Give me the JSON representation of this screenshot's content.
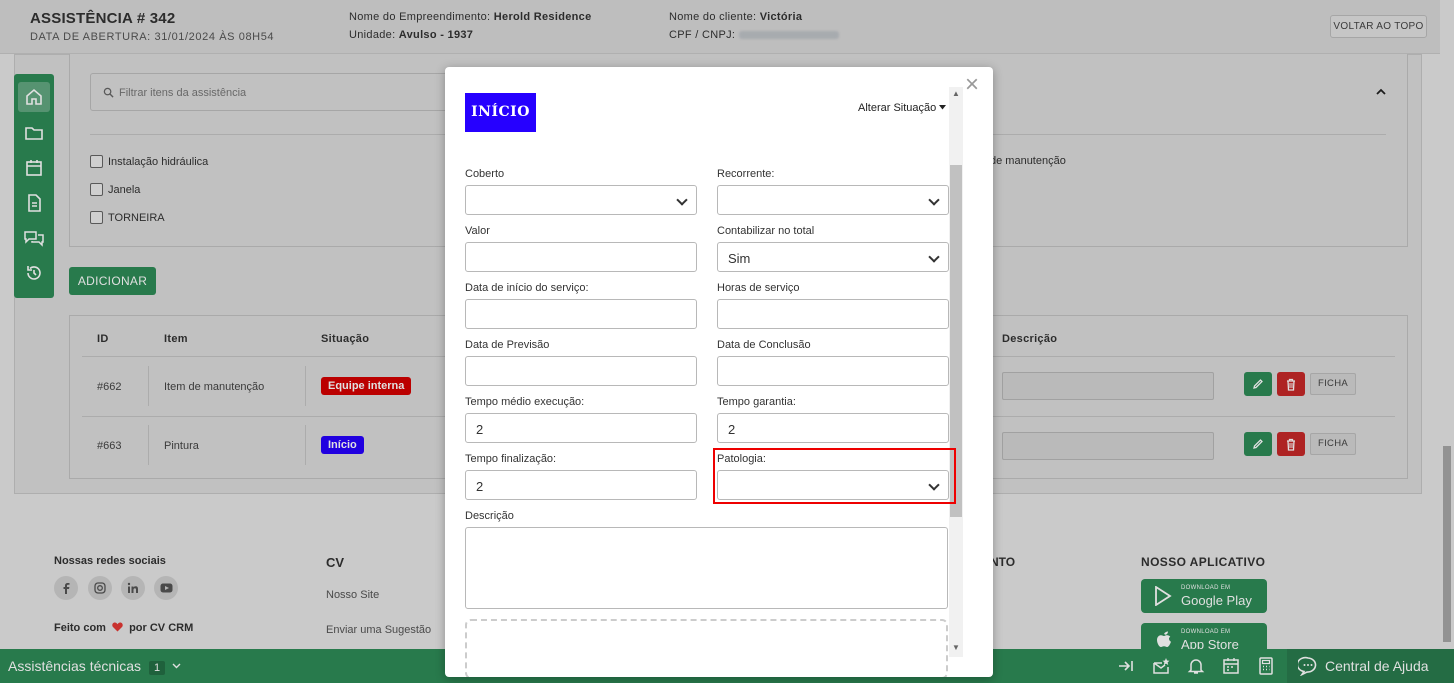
{
  "header": {
    "title": "ASSISTÊNCIA # 342",
    "opened": "DATA DE ABERTURA: 31/01/2024 ÀS 08H54",
    "enterprise_label": "Nome do Empreendimento:",
    "enterprise_value": "Herold Residence",
    "unit_label": "Unidade:",
    "unit_value": "Avulso - 1937",
    "client_label": "Nome do cliente:",
    "client_value": "Victória",
    "cpf_label": "CPF / CNPJ:",
    "back_top": "VOLTAR AO TOPO"
  },
  "filter": {
    "placeholder": "Filtrar itens da assistência"
  },
  "checkboxes": [
    "Instalação hidráulica",
    "Janela",
    "TORNEIRA",
    "de manutenção"
  ],
  "add_button": "ADICIONAR",
  "table": {
    "headers": [
      "ID",
      "Item",
      "Situação",
      "Descrição"
    ],
    "rows": [
      {
        "id": "#662",
        "item": "Item de manutenção",
        "status": "Equipe interna",
        "status_color": "#d50000"
      },
      {
        "id": "#663",
        "item": "Pintura",
        "status": "Início",
        "status_color": "#2600ff"
      }
    ],
    "ficha_label": "FICHA"
  },
  "footer": {
    "social_title": "Nossas redes sociais",
    "made_with_prefix": "Feito com",
    "made_with_suffix": "por CV CRM",
    "cv_title": "CV",
    "cv_links": [
      "Nosso Site",
      "Enviar uma Sugestão"
    ],
    "partial_title": "NTO",
    "app_title": "NOSSO APLICATIVO",
    "google_small": "DOWNLOAD EM",
    "google_big": "Google Play",
    "apple_small": "DOWNLOAD EM",
    "apple_big": "App Store"
  },
  "bottom_bar": {
    "label": "Assistências técnicas",
    "count": "1",
    "help": "Central de Ajuda"
  },
  "modal": {
    "status": "INÍCIO",
    "status_color": "#2600ff",
    "change_status": "Alterar Situação",
    "fields": {
      "coberto": {
        "label": "Coberto",
        "value": ""
      },
      "recorrente": {
        "label": "Recorrente:",
        "value": ""
      },
      "valor": {
        "label": "Valor",
        "value": ""
      },
      "contabilizar": {
        "label": "Contabilizar no total",
        "value": "Sim"
      },
      "data_inicio": {
        "label": "Data de início do serviço:",
        "value": ""
      },
      "horas": {
        "label": "Horas de serviço",
        "value": ""
      },
      "data_previsao": {
        "label": "Data de Previsão",
        "value": ""
      },
      "data_conclusao": {
        "label": "Data de Conclusão",
        "value": ""
      },
      "tempo_medio": {
        "label": "Tempo médio execução:",
        "value": "2"
      },
      "tempo_garantia": {
        "label": "Tempo garantia:",
        "value": "2"
      },
      "tempo_finalizacao": {
        "label": "Tempo finalização:",
        "value": "2"
      },
      "patologia": {
        "label": "Patologia:",
        "value": ""
      },
      "descricao": {
        "label": "Descrição",
        "value": ""
      }
    }
  },
  "colors": {
    "brand_green": "#2e8b57",
    "highlight_red": "#ee0000"
  }
}
